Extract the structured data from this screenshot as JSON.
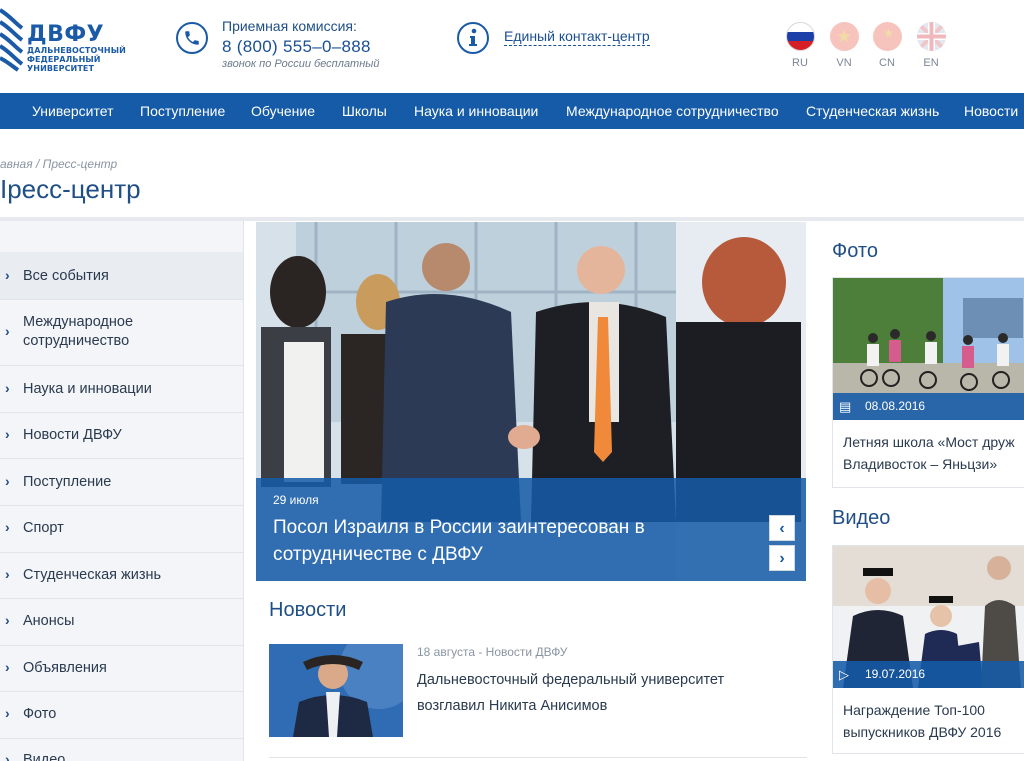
{
  "header": {
    "logo": {
      "abbr": "ДВФУ",
      "line1": "ДАЛЬНЕВОСТОЧНЫЙ",
      "line2": "ФЕДЕРАЛЬНЫЙ",
      "line3": "УНИВЕРСИТЕТ"
    },
    "admissions": {
      "title": "Приемная комиссия:",
      "phone": "8 (800) 555–0–888",
      "note": "звонок по России бесплатный"
    },
    "contact_center": "Единый контакт-центр",
    "languages": [
      {
        "code": "RU",
        "flag": "russia-flag"
      },
      {
        "code": "VN",
        "flag": "vietnam-flag"
      },
      {
        "code": "CN",
        "flag": "china-flag"
      },
      {
        "code": "EN",
        "flag": "uk-flag"
      }
    ]
  },
  "nav": {
    "items": [
      "Университет",
      "Поступление",
      "Обучение",
      "Школы",
      "Наука и инновации",
      "Международное сотрудничество",
      "Студенческая жизнь",
      "Новости"
    ]
  },
  "breadcrumb": {
    "home": "авная",
    "sep": " / ",
    "current": "Пресс-центр"
  },
  "page_title": "Iресс-центр",
  "sidebar": {
    "items": [
      "Все события",
      "Международное сотрудничество",
      "Наука и инновации",
      "Новости ДВФУ",
      "Поступление",
      "Спорт",
      "Студенческая жизнь",
      "Анонсы",
      "Объявления",
      "Фото",
      "Видео"
    ]
  },
  "hero": {
    "date": "29 июля",
    "title": "Посол Израиля в России заинтересован в сотрудничестве с ДВФУ",
    "prev": "‹",
    "next": "›"
  },
  "news": {
    "heading": "Новости",
    "items": [
      {
        "meta": "18 августа - Новости ДВФУ",
        "title": "Дальневосточный федеральный университет возглавил Никита Анисимов"
      }
    ]
  },
  "right": {
    "photo_heading": "Фото",
    "photo": {
      "date": "08.08.2016",
      "title1": "Летняя школа «Мост друж",
      "title2": "Владивосток – Яньцзи»"
    },
    "video_heading": "Видео",
    "video": {
      "date": "19.07.2016",
      "title1": "Награждение Топ-100",
      "title2": "выпускников ДВФУ 2016"
    }
  },
  "colors": {
    "brand": "#155ba8",
    "text": "#2a3a4f",
    "muted": "#8a95a3"
  }
}
